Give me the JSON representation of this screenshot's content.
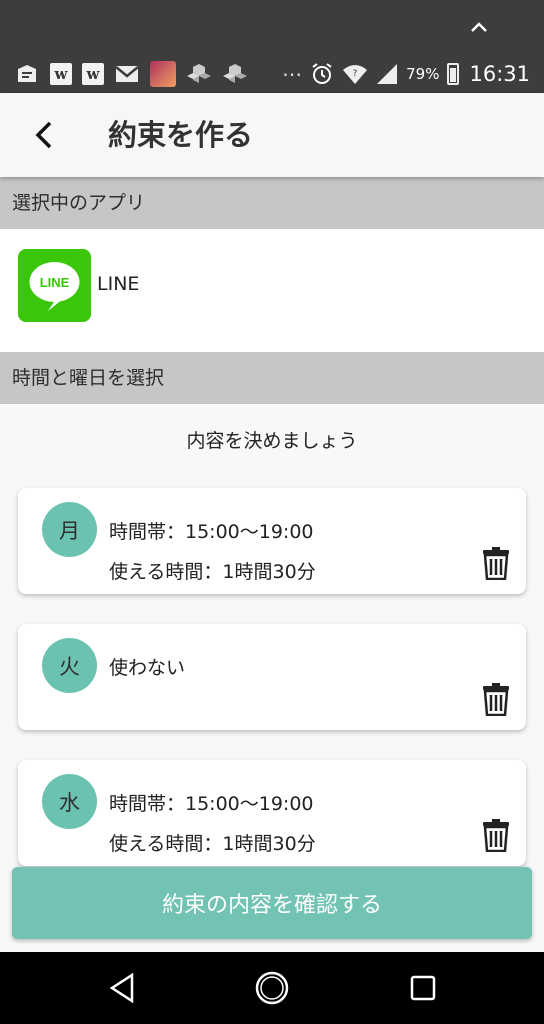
{
  "status_bar": {
    "battery": "79%",
    "time": "16:31",
    "dots": "⋯",
    "notif_icons": [
      "message-icon",
      "w",
      "w",
      "gmail-icon",
      "game-icon",
      "cube-icon",
      "cube-icon"
    ]
  },
  "app_bar": {
    "title": "約束を作る"
  },
  "selected_app": {
    "header": "選択中のアプリ",
    "name": "LINE",
    "logo_text": "LINE"
  },
  "schedule": {
    "header": "時間と曜日を選択",
    "prompt": "内容を決めましょう",
    "days": [
      {
        "day": "月",
        "line1": "時間帯：15:00〜19:00",
        "line2": "使える時間：1時間30分"
      },
      {
        "day": "火",
        "line1": "使わない",
        "line2": ""
      },
      {
        "day": "水",
        "line1": "時間帯：15:00〜19:00",
        "line2": "使える時間：1時間30分"
      }
    ]
  },
  "confirm_button": "約束の内容を確認する",
  "colors": {
    "accent": "#6cc2b1",
    "button": "#72c3b3",
    "line_green": "#3ac70a",
    "status_bar": "#3d3d3d"
  }
}
